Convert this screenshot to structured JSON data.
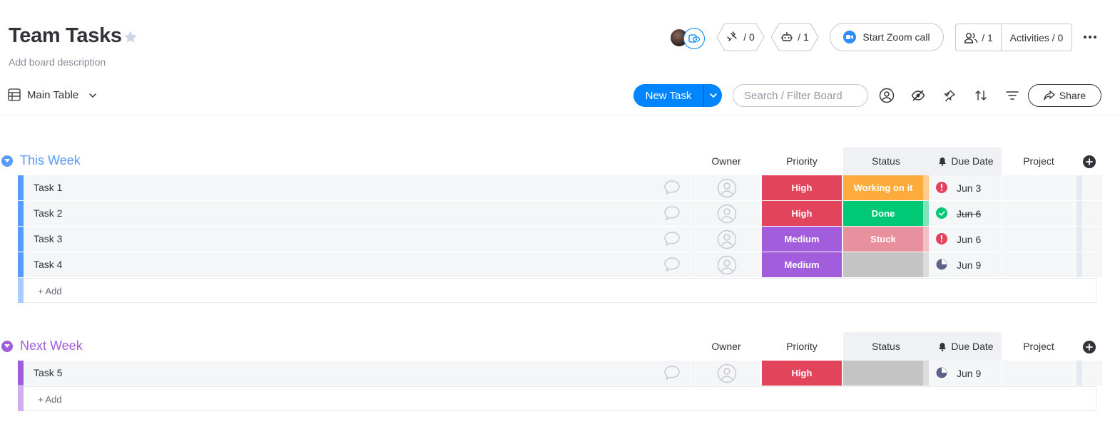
{
  "board": {
    "title": "Team Tasks",
    "description_placeholder": "Add board description"
  },
  "header": {
    "integrations_count": "/ 0",
    "automations_count": "/ 1",
    "zoom_label": "Start Zoom call",
    "members_count": "/ 1",
    "activities_label": "Activities / 0"
  },
  "toolbar": {
    "view_name": "Main Table",
    "new_task_label": "New Task",
    "search_placeholder": "Search / Filter Board",
    "share_label": "Share"
  },
  "columns": {
    "owner": "Owner",
    "priority": "Priority",
    "status": "Status",
    "due_date": "Due Date",
    "project": "Project"
  },
  "colors": {
    "accent": "#0085ff",
    "group_this_week": "#579bfc",
    "group_next_week": "#a25ddc",
    "priority_high": "#e2445c",
    "priority_medium": "#a25ddc",
    "status_working": "#fdab3d",
    "status_done": "#00c875",
    "status_stuck": "#e8909e",
    "status_empty": "#c4c4c4"
  },
  "groups": [
    {
      "title": "This Week",
      "add_label": "+ Add",
      "rows": [
        {
          "name": "Task 1",
          "priority": "High",
          "status": "Working on it",
          "due": "Jun 3",
          "due_state": "overdue"
        },
        {
          "name": "Task 2",
          "priority": "High",
          "status": "Done",
          "due": "Jun 6",
          "due_state": "done"
        },
        {
          "name": "Task 3",
          "priority": "Medium",
          "status": "Stuck",
          "due": "Jun 6",
          "due_state": "overdue"
        },
        {
          "name": "Task 4",
          "priority": "Medium",
          "status": "",
          "due": "Jun 9",
          "due_state": "upcoming"
        }
      ]
    },
    {
      "title": "Next Week",
      "add_label": "+ Add",
      "rows": [
        {
          "name": "Task 5",
          "priority": "High",
          "status": "",
          "due": "Jun 9",
          "due_state": "upcoming"
        }
      ]
    }
  ]
}
